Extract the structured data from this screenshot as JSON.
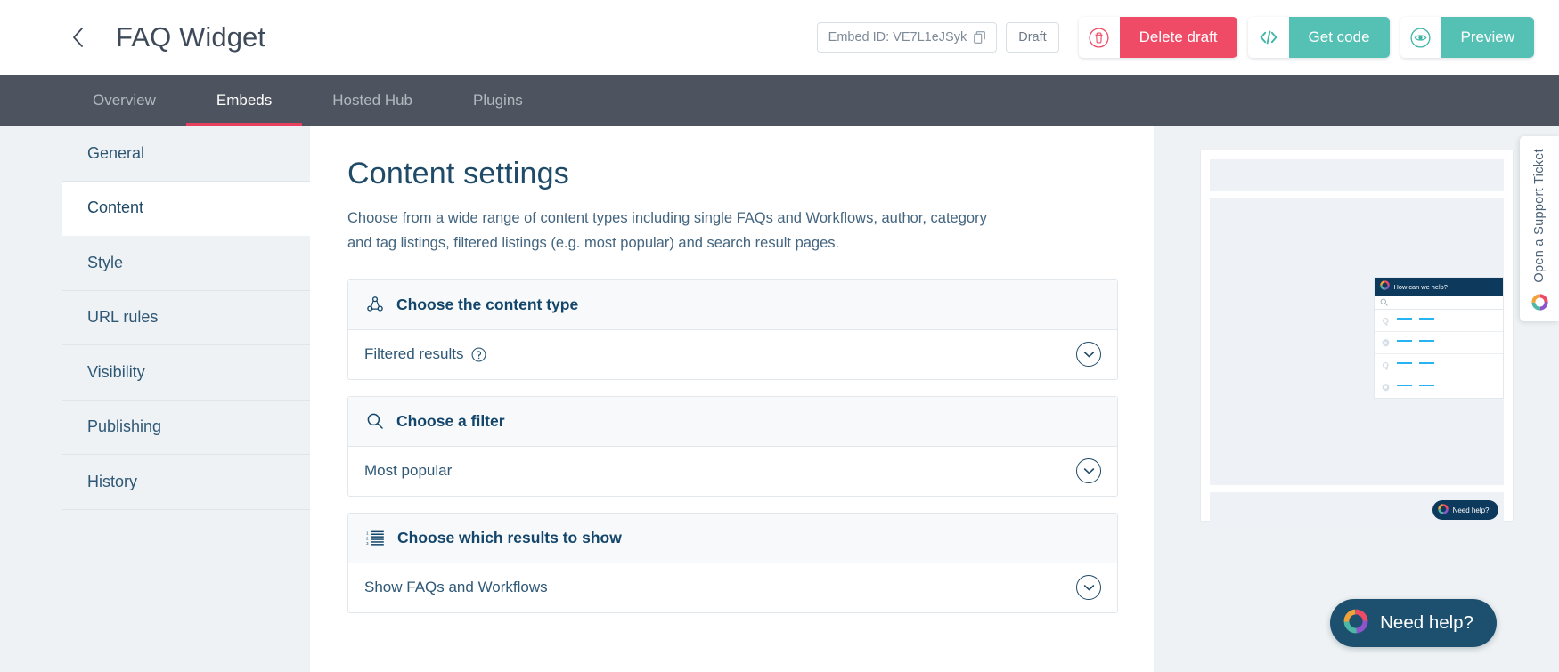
{
  "header": {
    "back_icon": "chevron-left-icon",
    "title": "FAQ Widget",
    "embed_id": "Embed ID: VE7L1eJSyk",
    "copy_icon": "copy-icon",
    "status": "Draft",
    "delete_draft": "Delete draft",
    "delete_icon": "trash-icon",
    "get_code": "Get code",
    "code_icon": "code-brackets-icon",
    "preview": "Preview",
    "preview_icon": "eye-icon",
    "danger_color": "#ef4b67",
    "teal_color": "#55c1b4"
  },
  "nav": {
    "tabs": [
      {
        "label": "Overview",
        "active": false
      },
      {
        "label": "Embeds",
        "active": true
      },
      {
        "label": "Hosted Hub",
        "active": false
      },
      {
        "label": "Plugins",
        "active": false
      }
    ],
    "active_indicator_color": "#e8415f",
    "background": "#4e545f"
  },
  "sidebar": {
    "items": [
      {
        "label": "General",
        "active": false
      },
      {
        "label": "Content",
        "active": true
      },
      {
        "label": "Style",
        "active": false
      },
      {
        "label": "URL rules",
        "active": false
      },
      {
        "label": "Visibility",
        "active": false
      },
      {
        "label": "Publishing",
        "active": false
      },
      {
        "label": "History",
        "active": false
      }
    ]
  },
  "main": {
    "title": "Content settings",
    "description": "Choose from a wide range of content types including single FAQs and Workflows, author, category and tag listings, filtered listings (e.g. most popular) and search result pages.",
    "cards": [
      {
        "icon": "share-nodes-icon",
        "heading": "Choose the content type",
        "value": "Filtered results",
        "has_help_icon": true,
        "help_icon": "question-circle-icon",
        "chevron_icon": "chevron-down-circle-icon"
      },
      {
        "icon": "search-icon",
        "heading": "Choose a filter",
        "value": "Most popular",
        "has_help_icon": false,
        "chevron_icon": "chevron-down-circle-icon"
      },
      {
        "icon": "ordered-list-icon",
        "heading": "Choose which results to show",
        "value": "Show FAQs and Workflows",
        "has_help_icon": false,
        "chevron_icon": "chevron-down-circle-icon"
      }
    ]
  },
  "preview": {
    "widget_title": "How can we help?",
    "search_icon": "search-icon",
    "logo_icon": "ring-logo-icon",
    "need_help_label": "Need help?",
    "results": [
      {
        "icon": "question-mark-icon"
      },
      {
        "icon": "gear-icon"
      },
      {
        "icon": "question-mark-icon"
      },
      {
        "icon": "gear-icon"
      }
    ]
  },
  "floating": {
    "need_help_label": "Need help?",
    "logo_icon": "ring-logo-icon",
    "background": "#1d506e"
  },
  "support_tab": {
    "label": "Open a Support Ticket",
    "logo_icon": "ring-logo-icon"
  }
}
